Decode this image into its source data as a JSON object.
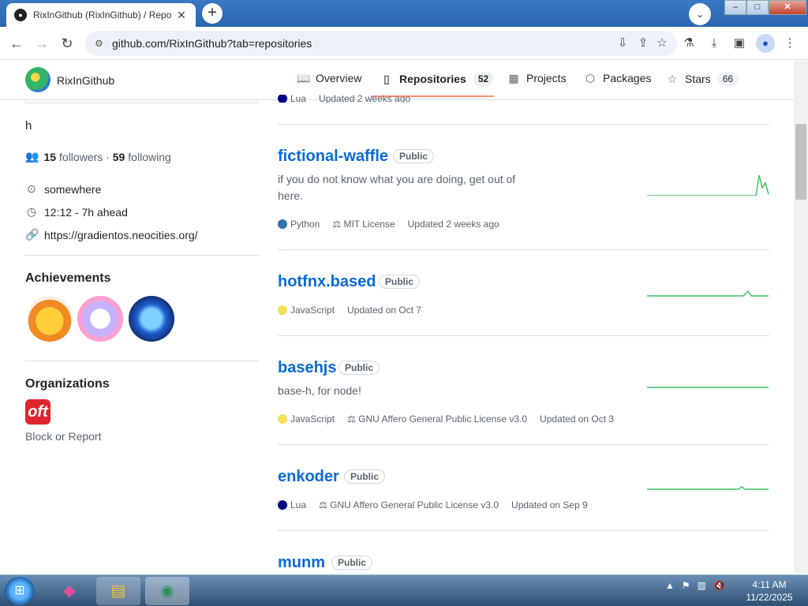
{
  "browser": {
    "tab_title": "RixInGithub (RixInGithub) / Repo",
    "url": "github.com/RixInGithub?tab=repositories"
  },
  "github_header": {
    "username": "RixInGithub",
    "tabs": [
      {
        "label": "Overview",
        "icon": "book-icon"
      },
      {
        "label": "Repositories",
        "icon": "repo-icon",
        "count": "52"
      },
      {
        "label": "Projects",
        "icon": "table-icon"
      },
      {
        "label": "Packages",
        "icon": "package-icon"
      },
      {
        "label": "Stars",
        "icon": "star-icon",
        "count": "66"
      }
    ]
  },
  "profile": {
    "bio": "h",
    "followers_count": "15",
    "followers_label": "followers",
    "separator": "·",
    "following_count": "59",
    "following_label": "following",
    "location": "somewhere",
    "time": "12:12 - 7h ahead",
    "website": "https://gradientos.neocities.org/",
    "achievements_title": "Achievements",
    "organizations_title": "Organizations",
    "org_logo_text": "oft",
    "block_report": "Block or Report"
  },
  "repos": [
    {
      "name": "fictional-waffle",
      "visibility": "Public",
      "description": "if you do not know what you are doing, get out of here.",
      "language": "Python",
      "lang_color": "#3572A5",
      "license": "MIT License",
      "updated": "Updated 2 weeks ago"
    },
    {
      "name": "hotfnx.based",
      "visibility": "Public",
      "description": "",
      "language": "JavaScript",
      "lang_color": "#f1e05a",
      "license": "",
      "updated": "Updated on Oct 7"
    },
    {
      "name": "basehjs",
      "visibility": "Public",
      "description": "base-h, for node!",
      "language": "JavaScript",
      "lang_color": "#f1e05a",
      "license": "GNU Affero General Public License v3.0",
      "updated": "Updated on Oct 3"
    },
    {
      "name": "enkoder",
      "visibility": "Public",
      "description": "",
      "language": "Lua",
      "lang_color": "#000080",
      "license": "GNU Affero General Public License v3.0",
      "updated": "Updated on Sep 9"
    },
    {
      "name": "munm",
      "visibility": "Public"
    }
  ],
  "partial_top_row": {
    "language": "Lua",
    "updated": "Updated 2 weeks ago"
  },
  "taskbar": {
    "time": "4:11 AM",
    "date": "11/22/2025"
  }
}
